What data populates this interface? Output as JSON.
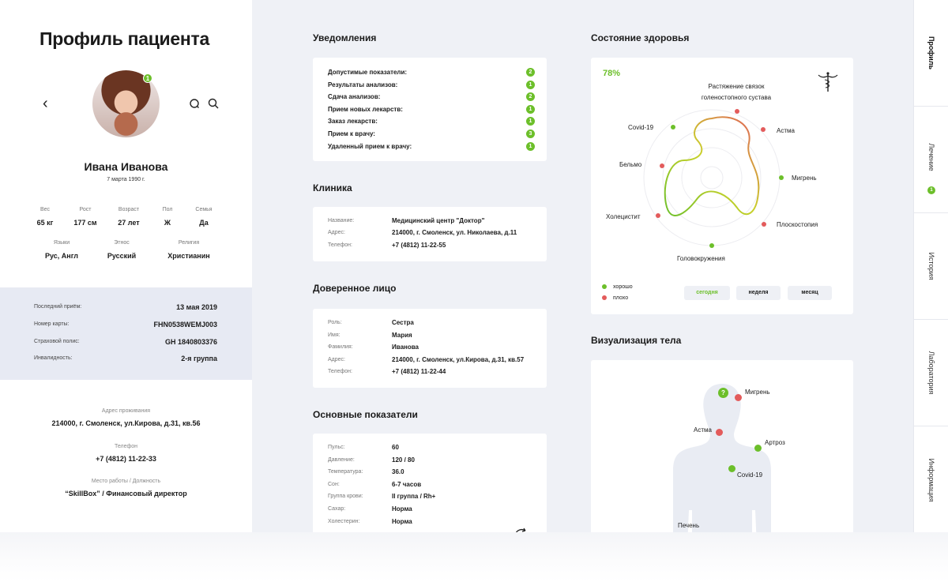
{
  "profile": {
    "title": "Профиль пациента",
    "notifications_badge": "1",
    "name": "Ивана Иванова",
    "dob": "7 марта 1990 г.",
    "stats": [
      {
        "label": "Вес",
        "value": "65 кг"
      },
      {
        "label": "Рост",
        "value": "177 см"
      },
      {
        "label": "Возраст",
        "value": "27 лет"
      },
      {
        "label": "Пол",
        "value": "Ж"
      },
      {
        "label": "Семья",
        "value": "Да"
      }
    ],
    "stats2": [
      {
        "label": "Языки",
        "value": "Рус, Англ"
      },
      {
        "label": "Этнос",
        "value": "Русский"
      },
      {
        "label": "Религия",
        "value": "Христианин"
      }
    ],
    "info": [
      {
        "label": "Последний приём:",
        "value": "13 мая 2019"
      },
      {
        "label": "Номер карты:",
        "value": "FHN0538WEMJ003"
      },
      {
        "label": "Страховой полис:",
        "value": "GH 1840803376"
      },
      {
        "label": "Инвалидность:",
        "value": "2-я группа"
      }
    ],
    "contacts": [
      {
        "label": "Адрес проживания",
        "value": "214000, г. Смоленск, ул.Кирова, д.31, кв.56"
      },
      {
        "label": "Телефон",
        "value": "+7 (4812) 11-22-33"
      },
      {
        "label": "Место работы / Должность",
        "value": "“SkillBox” / Финансовый директор"
      }
    ]
  },
  "notifications": {
    "title": "Уведомления",
    "items": [
      {
        "label": "Допустимые показатели:",
        "count": "2"
      },
      {
        "label": "Результаты анализов:",
        "count": "1"
      },
      {
        "label": "Сдача анализов:",
        "count": "2"
      },
      {
        "label": "Прием новых лекарств:",
        "count": "1"
      },
      {
        "label": "Заказ лекарств:",
        "count": "1"
      },
      {
        "label": "Прием к врачу:",
        "count": "3"
      },
      {
        "label": "Удаленный прием к врачу:",
        "count": "1"
      }
    ]
  },
  "clinic": {
    "title": "Клиника",
    "rows": [
      {
        "label": "Название:",
        "value": "Медицинский центр \"Доктор\""
      },
      {
        "label": "Адрес:",
        "value": "214000, г. Смоленск, ул. Николаева, д.11"
      },
      {
        "label": "Телефон:",
        "value": "+7 (4812) 11-22-55"
      }
    ]
  },
  "trustee": {
    "title": "Доверенное лицо",
    "rows": [
      {
        "label": "Роль:",
        "value": "Сестра"
      },
      {
        "label": "Имя:",
        "value": "Мария"
      },
      {
        "label": "Фамилия:",
        "value": "Иванова"
      },
      {
        "label": "Адрес:",
        "value": "214000, г. Смоленск, ул.Кирова, д.31, кв.57"
      },
      {
        "label": "Телефон:",
        "value": "+7 (4812) 11-22-44"
      }
    ]
  },
  "vitals": {
    "title": "Основные показатели",
    "rows": [
      {
        "label": "Пульс:",
        "value": "60"
      },
      {
        "label": "Давление:",
        "value": "120 / 80"
      },
      {
        "label": "Температура:",
        "value": "36.0"
      },
      {
        "label": "Сон:",
        "value": "6-7 часов"
      },
      {
        "label": "Группа крови:",
        "value": "II группа / Rh+"
      },
      {
        "label": "Сахар:",
        "value": "Норма"
      },
      {
        "label": "Холестерин:",
        "value": "Норма"
      }
    ]
  },
  "health": {
    "title": "Состояние здоровья",
    "percent": "78%",
    "legend_good": "хорошо",
    "legend_bad": "плохо",
    "periods": [
      "сегодня",
      "неделя",
      "месяц"
    ],
    "active_period": "сегодня",
    "colors": {
      "good": "#6cbf2a",
      "bad": "#e35b5b"
    },
    "labels": {
      "top_line1": "Растяжение связок",
      "top_line2": "голеностопного сустава",
      "asthma": "Астма",
      "migraine": "Мигрень",
      "flatfoot": "Плоскостопия",
      "dizziness": "Головокружения",
      "cholecystitis": "Холецистит",
      "cataract": "Бельмо",
      "covid": "Covid-19"
    }
  },
  "body": {
    "title": "Визуализация тела",
    "question_mark": "?",
    "labels": {
      "migraine": "Мигрень",
      "asthma": "Астма",
      "arthrosis": "Артроз",
      "covid": "Covid-19",
      "liver": "Печень"
    }
  },
  "nav": {
    "items": [
      "Профиль",
      "Лечение",
      "История",
      "Лаборатория",
      "Информация"
    ],
    "treatment_badge": "1"
  }
}
